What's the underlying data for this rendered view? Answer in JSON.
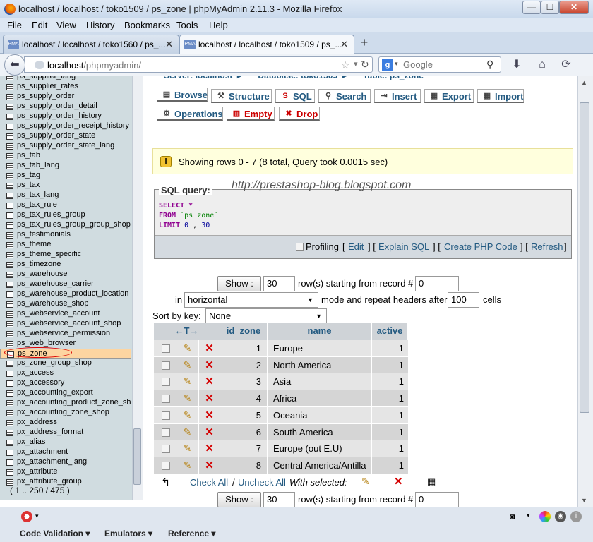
{
  "window": {
    "title": "localhost / localhost / toko1509 / ps_zone | phpMyAdmin 2.11.3 - Mozilla Firefox",
    "min": "—",
    "max": "☐",
    "close": "✕"
  },
  "menu": [
    "File",
    "Edit",
    "View",
    "History",
    "Bookmarks",
    "Tools",
    "Help"
  ],
  "tabs": [
    {
      "label": "localhost / localhost / toko1560 / ps_...",
      "close": "✕",
      "favicon": "PMA"
    },
    {
      "label": "localhost / localhost / toko1509 / ps_...",
      "close": "✕",
      "favicon": "PMA"
    }
  ],
  "newtab": "+",
  "nav": {
    "url_host": "localhost",
    "url_path": "/phpmyadmin/",
    "search_placeholder": "Google",
    "back": "⬅"
  },
  "sidebar": {
    "items": [
      "ps_supplier_lang",
      "ps_supplier_rates",
      "ps_supply_order",
      "ps_supply_order_detail",
      "ps_supply_order_history",
      "ps_supply_order_receipt_history",
      "ps_supply_order_state",
      "ps_supply_order_state_lang",
      "ps_tab",
      "ps_tab_lang",
      "ps_tag",
      "ps_tax",
      "ps_tax_lang",
      "ps_tax_rule",
      "ps_tax_rules_group",
      "ps_tax_rules_group_group_shop",
      "ps_testimonials",
      "ps_theme",
      "ps_theme_specific",
      "ps_timezone",
      "ps_warehouse",
      "ps_warehouse_carrier",
      "ps_warehouse_product_location",
      "ps_warehouse_shop",
      "ps_webservice_account",
      "ps_webservice_account_shop",
      "ps_webservice_permission",
      "ps_web_browser",
      "ps_zone",
      "ps_zone_group_shop",
      "px_access",
      "px_accessory",
      "px_accounting_export",
      "px_accounting_product_zone_shop",
      "px_accounting_zone_shop",
      "px_address",
      "px_address_format",
      "px_alias",
      "px_attachment",
      "px_attachment_lang",
      "px_attribute",
      "px_attribute_group"
    ],
    "selected_index": 28,
    "pager": "( 1 .. 250 / 475 )"
  },
  "table_tabs": [
    {
      "label": "Browse",
      "icon": "▤",
      "name": "tab-browse"
    },
    {
      "label": "Structure",
      "icon": "⚒",
      "name": "tab-structure"
    },
    {
      "label": "SQL",
      "icon": "S",
      "name": "tab-sql"
    },
    {
      "label": "Search",
      "icon": "⚲",
      "name": "tab-search"
    },
    {
      "label": "Insert",
      "icon": "⇥",
      "name": "tab-insert"
    },
    {
      "label": "Export",
      "icon": "▦",
      "name": "tab-export"
    },
    {
      "label": "Import",
      "icon": "▦",
      "name": "tab-import"
    },
    {
      "label": "Operations",
      "icon": "⚙",
      "name": "tab-operations"
    },
    {
      "label": "Empty",
      "icon": "▥",
      "name": "tab-empty"
    },
    {
      "label": "Drop",
      "icon": "✖",
      "name": "tab-drop"
    }
  ],
  "notice": {
    "icon": "i",
    "text": "Showing rows 0 - 7 (8 total, Query took 0.0015 sec)"
  },
  "watermark": "http://prestashop-blog.blogspot.com",
  "sql": {
    "legend": "SQL query:",
    "select": "SELECT",
    "star": " *",
    "from": "FROM",
    "table": " `ps_zone`",
    "limit": "LIMIT",
    "n0": " 0",
    "comma": " ,",
    "n30": " 30",
    "profiling": "Profiling",
    "edit": "Edit",
    "explain": "Explain SQL",
    "create_php": "Create PHP Code",
    "refresh": "Refresh",
    "lb": "[",
    "rb": "]",
    "sep": "] [",
    "sep2": "] [",
    "sep3": "] ["
  },
  "controls": {
    "show": "Show :",
    "rows": "30",
    "rows_text": "row(s) starting from record #",
    "start": "0",
    "in": "in",
    "mode": "horizontal",
    "mode_text": "mode and repeat headers after",
    "repeat": "100",
    "cells": "cells",
    "sort_label": "Sort by key:",
    "sort_value": "None"
  },
  "table": {
    "arrows": "←T→",
    "headers": [
      "id_zone",
      "name",
      "active"
    ],
    "rows": [
      {
        "id": "1",
        "name": "Europe",
        "active": "1"
      },
      {
        "id": "2",
        "name": "North America",
        "active": "1"
      },
      {
        "id": "3",
        "name": "Asia",
        "active": "1"
      },
      {
        "id": "4",
        "name": "Africa",
        "active": "1"
      },
      {
        "id": "5",
        "name": "Oceania",
        "active": "1"
      },
      {
        "id": "6",
        "name": "South America",
        "active": "1"
      },
      {
        "id": "7",
        "name": "Europe (out E.U)",
        "active": "1"
      },
      {
        "id": "8",
        "name": "Central America/Antilla",
        "active": "1"
      }
    ],
    "edit_icon": "✎",
    "delete_icon": "✕"
  },
  "footer_actions": {
    "check_all": "Check All",
    "slash": "/",
    "uncheck_all": "Uncheck All",
    "with_selected": "With selected:"
  },
  "controls2": {
    "show": "Show :",
    "rows": "30",
    "rows_text": "row(s) starting from record #",
    "start": "0"
  },
  "statusbar": {
    "code_validation": "Code Validation ▾",
    "emulators": "Emulators ▾",
    "reference": "Reference ▾"
  }
}
